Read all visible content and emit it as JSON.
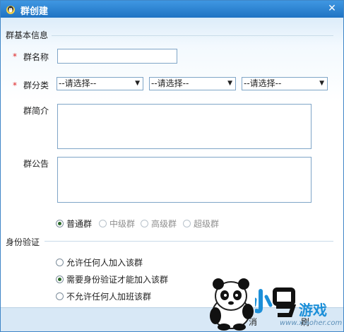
{
  "window": {
    "title": "群创建"
  },
  "form": {
    "section_basic": "群基本信息",
    "name": {
      "label": "群名称",
      "value": ""
    },
    "category": {
      "label": "群分类",
      "selects": [
        "--请选择--",
        "--请选择--",
        "--请选择--"
      ]
    },
    "intro": {
      "label": "群简介",
      "value": ""
    },
    "notice": {
      "label": "群公告",
      "value": ""
    },
    "group_types": [
      {
        "label": "普通群",
        "selected": true,
        "enabled": true
      },
      {
        "label": "中级群",
        "selected": false,
        "enabled": false
      },
      {
        "label": "高级群",
        "selected": false,
        "enabled": false
      },
      {
        "label": "超级群",
        "selected": false,
        "enabled": false
      }
    ],
    "section_auth": "身份验证",
    "auth_options": [
      {
        "label": "允许任何人加入该群",
        "selected": false
      },
      {
        "label": "需要身份验证才能加入该群",
        "selected": true
      },
      {
        "label": "不允许任何人加班该群",
        "selected": false
      }
    ]
  },
  "buttons": {
    "cancel": "消",
    "ok_partial": "刷"
  },
  "watermark": {
    "text": "游戏",
    "site": "www.xiaoher.com"
  },
  "colors": {
    "title_bar": "#2a80d0",
    "accent": "#3f86c7",
    "required": "#d22222"
  }
}
